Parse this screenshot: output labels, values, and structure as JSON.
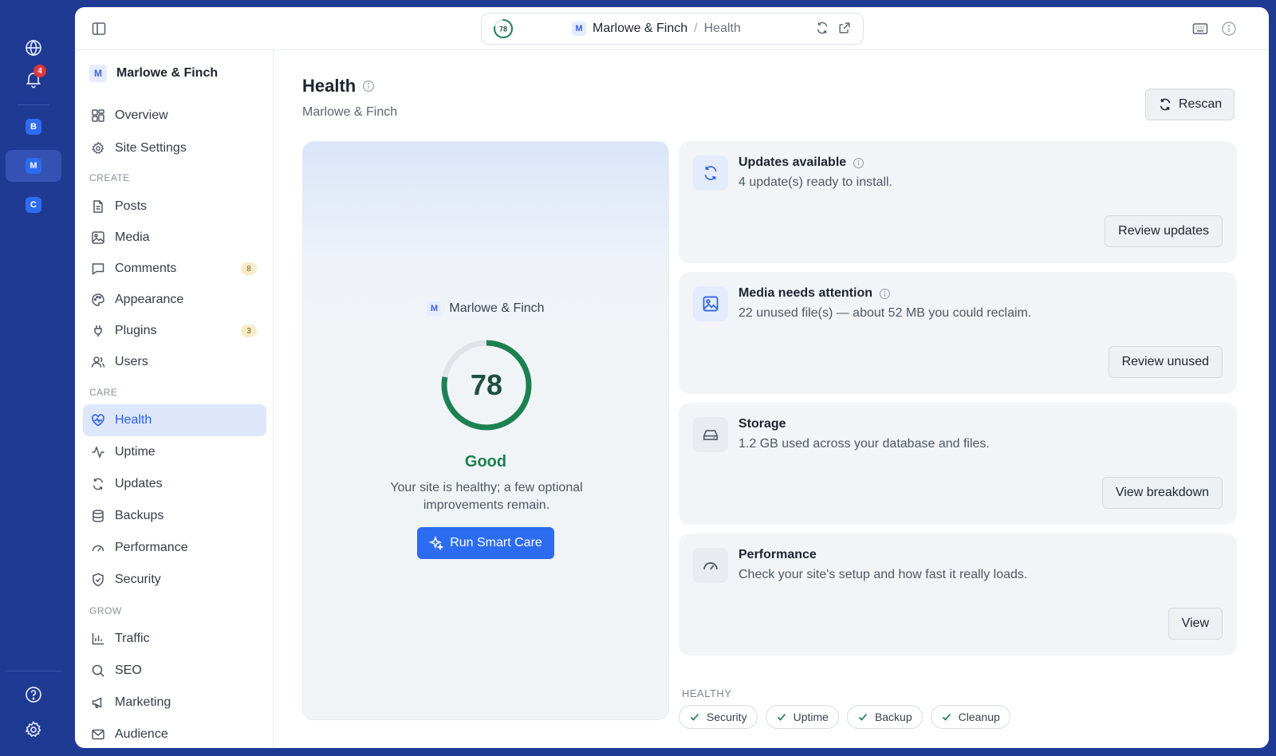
{
  "rail": {
    "notifications_count": "4",
    "sites": [
      {
        "letter": "B"
      },
      {
        "letter": "M"
      },
      {
        "letter": "C"
      }
    ]
  },
  "topbar": {
    "score": "78",
    "site_letter": "M",
    "site_name": "Marlowe & Finch",
    "separator": "/",
    "page": "Health"
  },
  "sidebar": {
    "site_letter": "M",
    "site_name": "Marlowe & Finch",
    "items": {
      "overview": "Overview",
      "site_settings": "Site Settings",
      "posts": "Posts",
      "media": "Media",
      "comments": "Comments",
      "comments_count": "8",
      "appearance": "Appearance",
      "plugins": "Plugins",
      "plugins_count": "3",
      "users": "Users",
      "health": "Health",
      "uptime": "Uptime",
      "updates": "Updates",
      "backups": "Backups",
      "performance": "Performance",
      "security": "Security",
      "traffic": "Traffic",
      "seo": "SEO",
      "marketing": "Marketing",
      "audience": "Audience"
    },
    "sections": {
      "create": "CREATE",
      "care": "CARE",
      "grow": "GROW"
    }
  },
  "main": {
    "title": "Health",
    "subtitle": "Marlowe & Finch",
    "rescan_label": "Rescan",
    "score_card": {
      "site_letter": "M",
      "site_name": "Marlowe & Finch",
      "score": "78",
      "score_value": 78,
      "status": "Good",
      "description": "Your site is healthy; a few optional improvements remain.",
      "action_label": "Run Smart Care"
    },
    "cards": [
      {
        "title": "Updates available",
        "description": "4 update(s) ready to install.",
        "button": "Review updates"
      },
      {
        "title": "Media needs attention",
        "description": "22 unused file(s) — about 52 MB you could reclaim.",
        "button": "Review unused"
      },
      {
        "title": "Storage",
        "description": "1.2 GB used across your database and files.",
        "button": "View breakdown"
      },
      {
        "title": "Performance",
        "description": "Check your site's setup and how fast it really loads.",
        "button": "View"
      }
    ],
    "healthy_label": "HEALTHY",
    "healthy_pills": [
      "Security",
      "Uptime",
      "Backup",
      "Cleanup"
    ]
  },
  "colors": {
    "rail_bg": "#1f3a93",
    "accent": "#2c6cf0",
    "good": "#1c8150"
  }
}
